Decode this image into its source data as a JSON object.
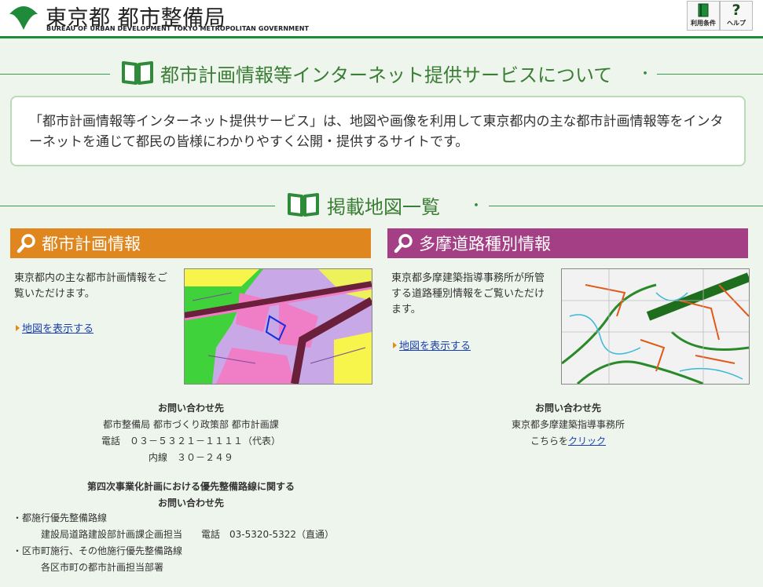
{
  "header": {
    "title": "東京都 都市整備局",
    "subtitle": "BUREAU OF URBAN DEVELOPMENT TOKYO METROPOLITAN GOVERNMENT",
    "terms_label": "利用条件",
    "help_label": "ヘルプ",
    "help_glyph": "?",
    "brand_color": "#1e8a3a"
  },
  "about": {
    "heading": "都市計画情報等インターネット提供サービスについて",
    "heading_dot": "・",
    "text": "「都市計画情報等インターネット提供サービス」は、地図や画像を利用して東京都内の主な都市計画情報等をインターネットを通じて都民の皆様にわかりやすく公開・提供するサイトです。"
  },
  "maps": {
    "heading": "掲載地図一覧",
    "heading_dot": "・"
  },
  "panels": [
    {
      "title": "都市計画情報",
      "color": "#e0861e",
      "description": "東京都内の主な都市計画情報をご覧いただけます。",
      "link": "地図を表示する"
    },
    {
      "title": "多摩道路種別情報",
      "color": "#a43f86",
      "description": "東京都多摩建築指導事務所が所管する道路種別情報をご覧いただけます。",
      "link": "地図を表示する"
    }
  ],
  "contact1": {
    "heading": "お問い合わせ先",
    "line1": "都市整備局 都市づくり政策部 都市計画課",
    "line2": "電話　０３－５３２１－１１１１（代表）",
    "line3": "内線　３０－２４９"
  },
  "contact2": {
    "heading": "お問い合わせ先",
    "line1": "東京都多摩建築指導事務所",
    "prefix": "こちらを",
    "link": "クリック"
  },
  "priority": {
    "heading1": "第四次事業化計画における優先整備路線に関する",
    "heading2": "お問い合わせ先",
    "item1": "・都施行優先整備路線",
    "item1_sub": "建設局道路建設部計画課企画担当　　電話　03-5320-5322（直通）",
    "item2": "・区市町施行、その他施行優先整備路線",
    "item2_sub": "各区市町の都市計画担当部署"
  }
}
